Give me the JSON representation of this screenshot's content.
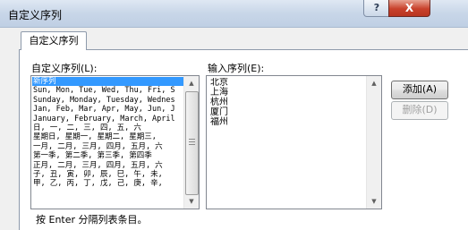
{
  "window": {
    "title": "自定义序列",
    "help_label": "?",
    "close_label": "X"
  },
  "tab": {
    "label": "自定义序列"
  },
  "custom_lists": {
    "label": "自定义序列(L):",
    "items": [
      "新序列",
      "Sun, Mon, Tue, Wed, Thu, Fri, S",
      "Sunday, Monday, Tuesday, Wednes",
      "Jan, Feb, Mar, Apr, May, Jun, J",
      "January, February, March, April",
      "日, 一, 二, 三, 四, 五, 六",
      "星期日, 星期一, 星期二, 星期三,",
      "一月, 二月, 三月, 四月, 五月, 六",
      "第一季, 第二季, 第三季, 第四季",
      "正月, 二月, 三月, 四月, 五月, 六",
      "子, 丑, 寅, 卯, 辰, 巳, 午, 未,",
      "甲, 乙, 丙, 丁, 戊, 己, 庚, 辛,"
    ],
    "selected_index": 0
  },
  "input_list": {
    "label": "输入序列(E):",
    "value": "北京\n上海\n杭州\n厦门\n福州"
  },
  "buttons": {
    "add": "添加(A)",
    "delete": "删除(D)"
  },
  "hint": "按 Enter 分隔列表条目。",
  "colors": {
    "selection": "#3399ff",
    "close_button": "#c8412b"
  }
}
